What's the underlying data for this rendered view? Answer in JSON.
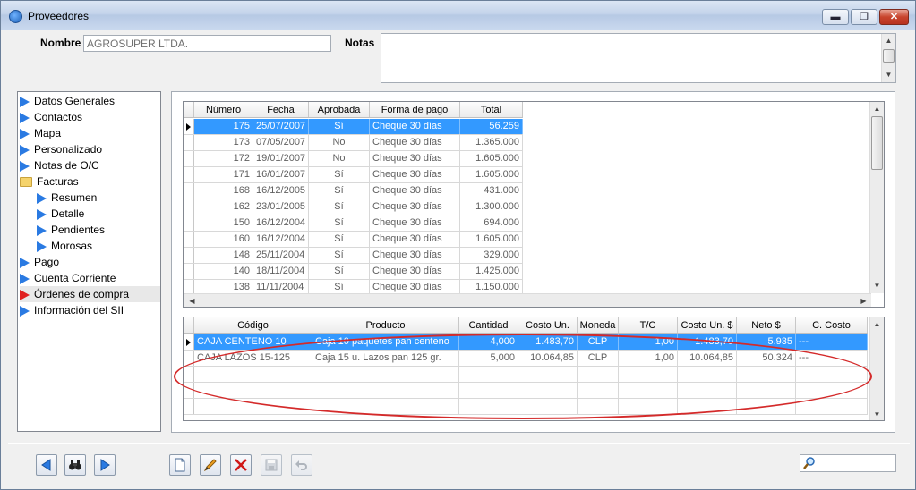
{
  "window": {
    "title": "Proveedores",
    "min_label": "▬",
    "max_label": "❐",
    "close_label": "✕"
  },
  "form": {
    "nombre_label": "Nombre",
    "nombre_value": "AGROSUPER LTDA.",
    "notas_label": "Notas",
    "notas_value": ""
  },
  "sidebar": {
    "items": [
      {
        "label": "Datos Generales"
      },
      {
        "label": "Contactos"
      },
      {
        "label": "Mapa"
      },
      {
        "label": "Personalizado"
      },
      {
        "label": "Notas de O/C"
      },
      {
        "label": "Facturas"
      },
      {
        "label": "Resumen"
      },
      {
        "label": "Detalle"
      },
      {
        "label": "Pendientes"
      },
      {
        "label": "Morosas"
      },
      {
        "label": "Pago"
      },
      {
        "label": "Cuenta Corriente"
      },
      {
        "label": "Órdenes de compra"
      },
      {
        "label": "Información del SII"
      }
    ]
  },
  "orders": {
    "headers": [
      "Número",
      "Fecha",
      "Aprobada",
      "Forma de pago",
      "Total"
    ],
    "rows": [
      [
        "175",
        "25/07/2007",
        "Sí",
        "Cheque 30 días",
        "56.259"
      ],
      [
        "173",
        "07/05/2007",
        "No",
        "Cheque 30 días",
        "1.365.000"
      ],
      [
        "172",
        "19/01/2007",
        "No",
        "Cheque 30 días",
        "1.605.000"
      ],
      [
        "171",
        "16/01/2007",
        "Sí",
        "Cheque 30 días",
        "1.605.000"
      ],
      [
        "168",
        "16/12/2005",
        "Sí",
        "Cheque 30 días",
        "431.000"
      ],
      [
        "162",
        "23/01/2005",
        "Sí",
        "Cheque 30 días",
        "1.300.000"
      ],
      [
        "150",
        "16/12/2004",
        "Sí",
        "Cheque 30 días",
        "694.000"
      ],
      [
        "160",
        "16/12/2004",
        "Sí",
        "Cheque 30 días",
        "1.605.000"
      ],
      [
        "148",
        "25/11/2004",
        "Sí",
        "Cheque 30 días",
        "329.000"
      ],
      [
        "140",
        "18/11/2004",
        "Sí",
        "Cheque 30 días",
        "1.425.000"
      ],
      [
        "138",
        "11/11/2004",
        "Sí",
        "Cheque 30 días",
        "1.150.000"
      ]
    ]
  },
  "details": {
    "headers": [
      "Código",
      "Producto",
      "Cantidad",
      "Costo Un.",
      "Moneda",
      "T/C",
      "Costo Un. $",
      "Neto $",
      "C. Costo"
    ],
    "rows": [
      [
        "CAJA CENTENO 10",
        "Caja 10 paquetes pan centeno",
        "4,000",
        "1.483,70",
        "CLP",
        "1,00",
        "1.483,70",
        "5.935",
        "---"
      ],
      [
        "CAJA LAZOS 15-125",
        "Caja 15 u. Lazos pan 125 gr.",
        "5,000",
        "10.064,85",
        "CLP",
        "1,00",
        "10.064,85",
        "50.324",
        "---"
      ]
    ]
  },
  "toolbar": {
    "search_value": ""
  },
  "colors": {
    "selection": "#3399ff",
    "annotation": "#d42a2a",
    "tree_arrow": "#2a7ae2",
    "tree_arrow_active": "#e02020"
  }
}
